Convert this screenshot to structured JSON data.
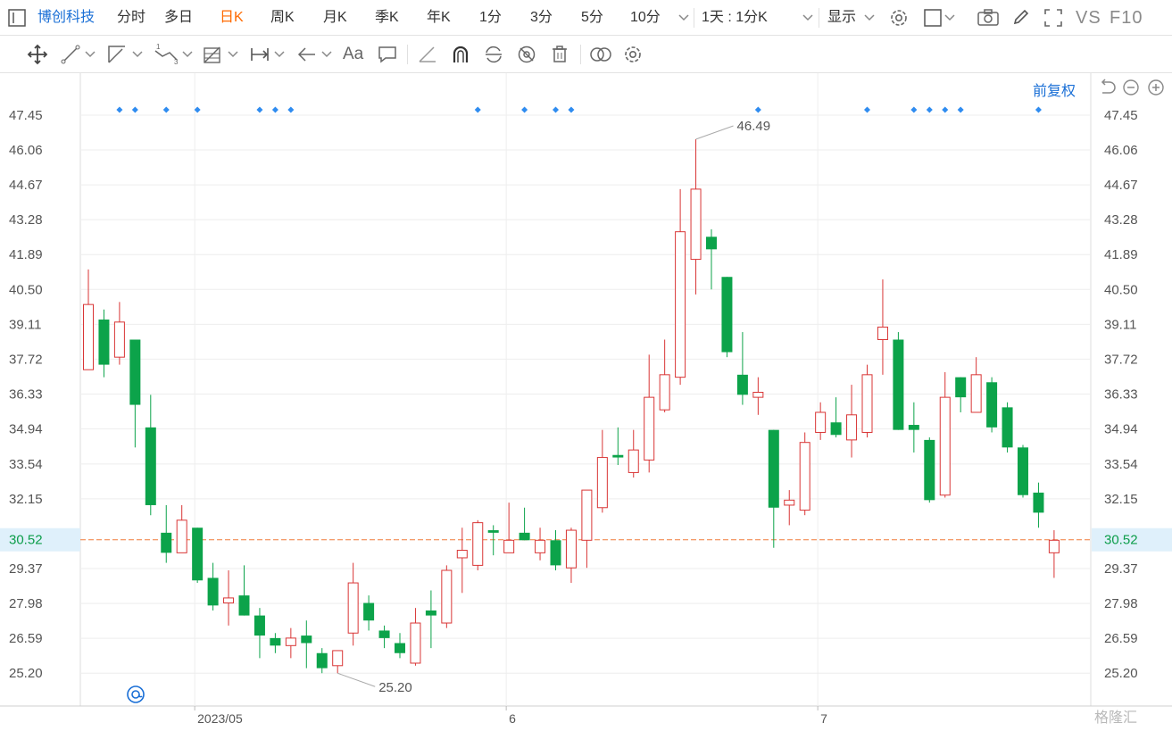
{
  "toolbar": {
    "stock_name": "博创科技",
    "periods": [
      "分时",
      "多日",
      "日K",
      "周K",
      "月K",
      "季K",
      "年K",
      "1分",
      "3分",
      "5分",
      "10分"
    ],
    "active_period": "日K",
    "interval_label": "1天 : 1分K",
    "display_label": "显示",
    "vs_label": "VS",
    "f10_label": "F10"
  },
  "drawing_tools": {
    "font_label": "Aa"
  },
  "adjust_label": "前复权",
  "watermark": "格隆汇",
  "colors": {
    "up": "#d93535",
    "down": "#0ca34a",
    "accent": "#1a6fd6",
    "active": "#ff6a00",
    "current": "#f07c3a"
  },
  "chart_data": {
    "type": "candlestick",
    "y_ticks": [
      "47.45",
      "46.06",
      "44.67",
      "43.28",
      "41.89",
      "40.50",
      "39.11",
      "37.72",
      "36.33",
      "34.94",
      "33.54",
      "32.15",
      "30.52",
      "29.37",
      "27.98",
      "26.59",
      "25.20"
    ],
    "ylim": [
      24.2,
      47.9
    ],
    "x_labels": [
      {
        "label": "2023/05",
        "index": 7
      },
      {
        "label": "6",
        "index": 27
      },
      {
        "label": "7",
        "index": 47
      }
    ],
    "current_price": "30.52",
    "annotations": [
      {
        "label": "46.49",
        "index": 39,
        "value": 46.49
      },
      {
        "label": "25.20",
        "index": 16,
        "value": 25.2
      }
    ],
    "event_marker_indices": [
      2,
      3,
      5,
      7,
      11,
      12,
      13,
      25,
      28,
      30,
      31,
      43,
      50,
      53,
      54,
      55,
      56,
      61
    ],
    "candles": [
      {
        "o": 37.3,
        "c": 39.9,
        "h": 41.3,
        "l": 37.3
      },
      {
        "o": 39.3,
        "c": 37.5,
        "h": 39.7,
        "l": 37.0
      },
      {
        "o": 37.8,
        "c": 39.2,
        "h": 40.0,
        "l": 37.5
      },
      {
        "o": 38.5,
        "c": 35.9,
        "h": 38.5,
        "l": 34.2
      },
      {
        "o": 35.0,
        "c": 31.9,
        "h": 36.3,
        "l": 31.5
      },
      {
        "o": 30.8,
        "c": 30.0,
        "h": 31.9,
        "l": 29.6
      },
      {
        "o": 30.0,
        "c": 31.3,
        "h": 31.9,
        "l": 30.0
      },
      {
        "o": 31.0,
        "c": 28.9,
        "h": 31.0,
        "l": 28.8
      },
      {
        "o": 29.0,
        "c": 27.9,
        "h": 29.6,
        "l": 27.7
      },
      {
        "o": 28.0,
        "c": 28.2,
        "h": 29.3,
        "l": 27.1
      },
      {
        "o": 28.3,
        "c": 27.5,
        "h": 29.5,
        "l": 27.5
      },
      {
        "o": 27.5,
        "c": 26.7,
        "h": 27.8,
        "l": 25.8
      },
      {
        "o": 26.6,
        "c": 26.3,
        "h": 26.8,
        "l": 26.0
      },
      {
        "o": 26.3,
        "c": 26.6,
        "h": 27.0,
        "l": 25.8
      },
      {
        "o": 26.7,
        "c": 26.4,
        "h": 27.3,
        "l": 25.4
      },
      {
        "o": 26.0,
        "c": 25.4,
        "h": 26.2,
        "l": 25.2
      },
      {
        "o": 25.5,
        "c": 26.1,
        "h": 26.1,
        "l": 25.2
      },
      {
        "o": 26.8,
        "c": 28.8,
        "h": 29.6,
        "l": 26.3
      },
      {
        "o": 28.0,
        "c": 27.3,
        "h": 28.3,
        "l": 26.9
      },
      {
        "o": 26.9,
        "c": 26.6,
        "h": 27.1,
        "l": 26.2
      },
      {
        "o": 26.4,
        "c": 26.0,
        "h": 26.8,
        "l": 25.8
      },
      {
        "o": 25.6,
        "c": 27.2,
        "h": 27.8,
        "l": 25.5
      },
      {
        "o": 27.7,
        "c": 27.5,
        "h": 28.5,
        "l": 26.2
      },
      {
        "o": 27.2,
        "c": 29.3,
        "h": 29.5,
        "l": 27.0
      },
      {
        "o": 29.8,
        "c": 30.1,
        "h": 31.0,
        "l": 28.4
      },
      {
        "o": 29.5,
        "c": 31.2,
        "h": 31.3,
        "l": 29.3
      },
      {
        "o": 30.9,
        "c": 30.8,
        "h": 31.1,
        "l": 29.9
      },
      {
        "o": 30.0,
        "c": 30.5,
        "h": 32.0,
        "l": 30.0
      },
      {
        "o": 30.8,
        "c": 30.5,
        "h": 31.8,
        "l": 30.5
      },
      {
        "o": 30.0,
        "c": 30.5,
        "h": 31.0,
        "l": 29.7
      },
      {
        "o": 30.5,
        "c": 29.5,
        "h": 30.9,
        "l": 29.3
      },
      {
        "o": 29.4,
        "c": 30.9,
        "h": 31.0,
        "l": 28.8
      },
      {
        "o": 30.5,
        "c": 32.5,
        "h": 32.5,
        "l": 29.4
      },
      {
        "o": 31.8,
        "c": 33.8,
        "h": 34.9,
        "l": 31.6
      },
      {
        "o": 33.9,
        "c": 33.8,
        "h": 35.0,
        "l": 33.5
      },
      {
        "o": 33.2,
        "c": 34.1,
        "h": 34.9,
        "l": 33.0
      },
      {
        "o": 33.7,
        "c": 36.2,
        "h": 37.9,
        "l": 33.2
      },
      {
        "o": 35.7,
        "c": 37.1,
        "h": 38.5,
        "l": 35.6
      },
      {
        "o": 37.0,
        "c": 42.8,
        "h": 44.5,
        "l": 36.7
      },
      {
        "o": 41.7,
        "c": 44.5,
        "h": 46.49,
        "l": 40.3
      },
      {
        "o": 42.6,
        "c": 42.1,
        "h": 42.9,
        "l": 40.5
      },
      {
        "o": 41.0,
        "c": 38.0,
        "h": 41.0,
        "l": 37.8
      },
      {
        "o": 37.1,
        "c": 36.3,
        "h": 38.8,
        "l": 35.9
      },
      {
        "o": 36.2,
        "c": 36.4,
        "h": 37.0,
        "l": 35.5
      },
      {
        "o": 34.9,
        "c": 31.8,
        "h": 34.9,
        "l": 30.2
      },
      {
        "o": 31.9,
        "c": 32.1,
        "h": 32.5,
        "l": 31.1
      },
      {
        "o": 31.7,
        "c": 34.4,
        "h": 34.8,
        "l": 31.5
      },
      {
        "o": 34.8,
        "c": 35.6,
        "h": 36.0,
        "l": 34.5
      },
      {
        "o": 35.2,
        "c": 34.7,
        "h": 36.2,
        "l": 34.6
      },
      {
        "o": 34.5,
        "c": 35.5,
        "h": 36.7,
        "l": 33.8
      },
      {
        "o": 34.8,
        "c": 37.1,
        "h": 37.5,
        "l": 34.6
      },
      {
        "o": 38.5,
        "c": 39.0,
        "h": 40.9,
        "l": 37.1
      },
      {
        "o": 38.5,
        "c": 34.9,
        "h": 38.8,
        "l": 34.9
      },
      {
        "o": 35.1,
        "c": 34.9,
        "h": 36.0,
        "l": 34.0
      },
      {
        "o": 34.5,
        "c": 32.1,
        "h": 34.6,
        "l": 32.0
      },
      {
        "o": 32.3,
        "c": 36.2,
        "h": 37.2,
        "l": 32.2
      },
      {
        "o": 37.0,
        "c": 36.2,
        "h": 37.0,
        "l": 35.6
      },
      {
        "o": 35.6,
        "c": 37.1,
        "h": 37.8,
        "l": 35.6
      },
      {
        "o": 36.8,
        "c": 35.0,
        "h": 37.0,
        "l": 34.8
      },
      {
        "o": 35.8,
        "c": 34.2,
        "h": 36.0,
        "l": 34.0
      },
      {
        "o": 34.2,
        "c": 32.3,
        "h": 34.3,
        "l": 32.2
      },
      {
        "o": 32.4,
        "c": 31.6,
        "h": 32.8,
        "l": 31.0
      },
      {
        "o": 30.0,
        "c": 30.5,
        "h": 30.9,
        "l": 29.0
      }
    ]
  }
}
